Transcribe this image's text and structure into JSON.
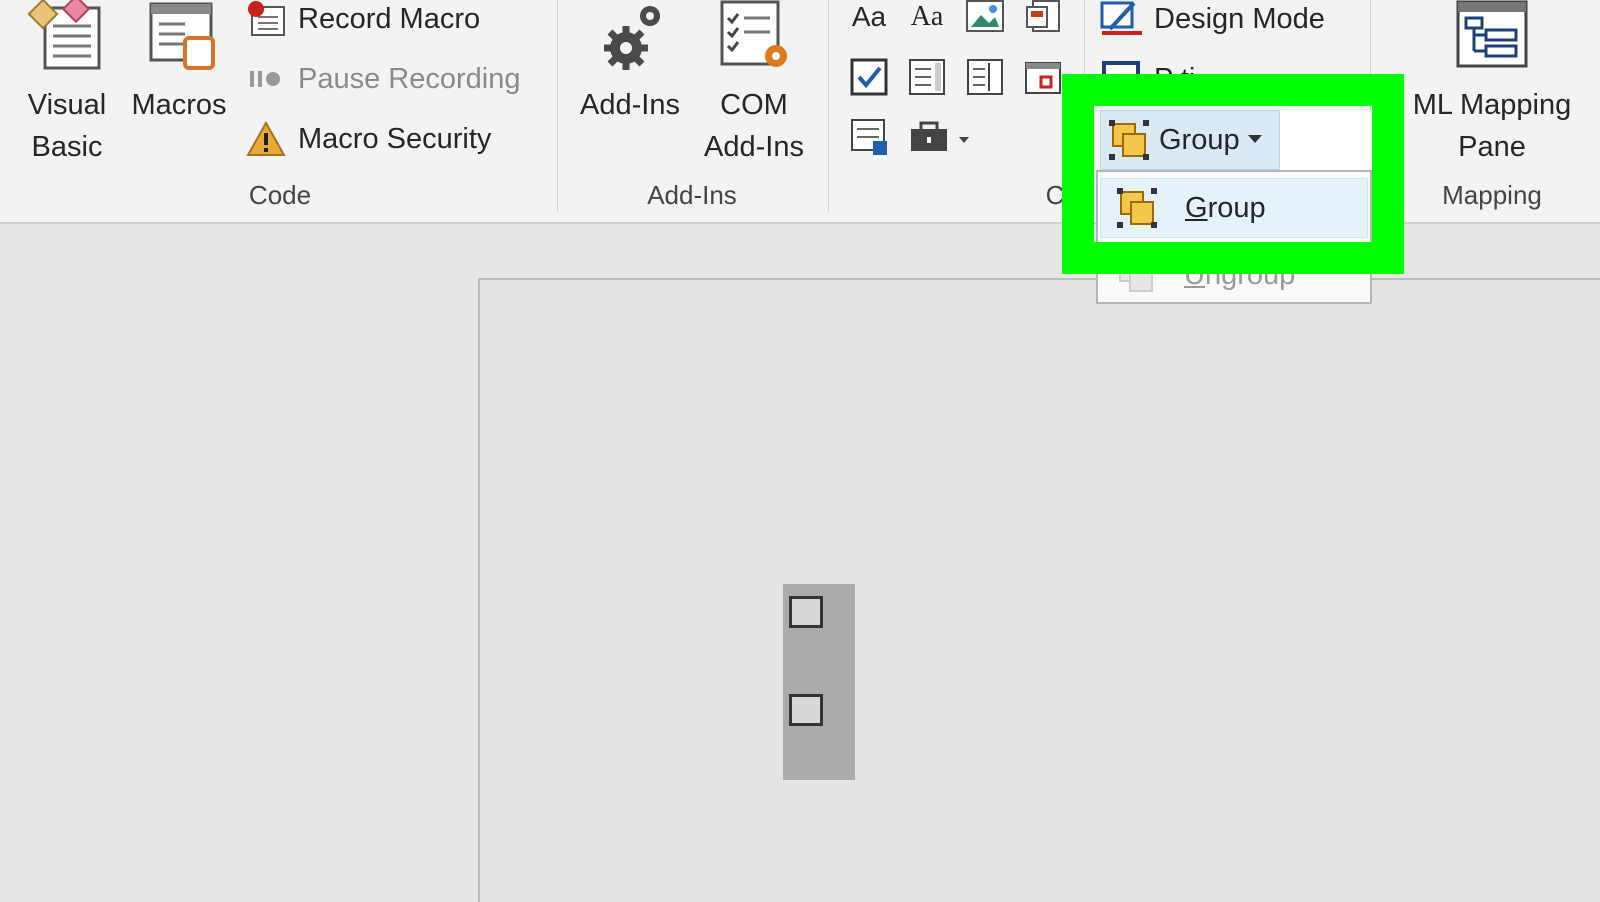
{
  "ribbon": {
    "code": {
      "label": "Code",
      "visual_basic": [
        "Visual",
        "Basic"
      ],
      "macros": "Macros",
      "record_macro": "Record Macro",
      "pause_recording": "Pause Recording",
      "macro_security": "Macro Security"
    },
    "addins": {
      "label": "Add-Ins",
      "add_ins": "Add-Ins",
      "com_add_ins": [
        "COM",
        "Add-Ins"
      ]
    },
    "controls": {
      "label_partial": "C",
      "rich_text": "Aa",
      "plain_text": "Aa",
      "design_mode": "Design Mode",
      "properties_partial": "P        ti"
    },
    "mapping": {
      "label": "Mapping",
      "xml_mapping_pane": [
        "ML Mapping",
        "Pane"
      ]
    }
  },
  "group_menu": {
    "button_label": "Group",
    "items": [
      {
        "label_first": "G",
        "label_rest": "roup",
        "enabled": true
      },
      {
        "label_first": "U",
        "label_rest": "ngroup",
        "enabled": false
      }
    ]
  },
  "colors": {
    "highlight": "#00ff00",
    "ribbon_bg": "#f3f3f3",
    "hover_blue": "#dbe9f7"
  },
  "icons": [
    "visual-basic-icon",
    "macros-icon",
    "record-macro-icon",
    "pause-recording-icon",
    "macro-security-icon",
    "add-ins-icon",
    "com-add-ins-icon",
    "checkbox-control-icon",
    "group-icon",
    "xml-mapping-pane-icon"
  ]
}
